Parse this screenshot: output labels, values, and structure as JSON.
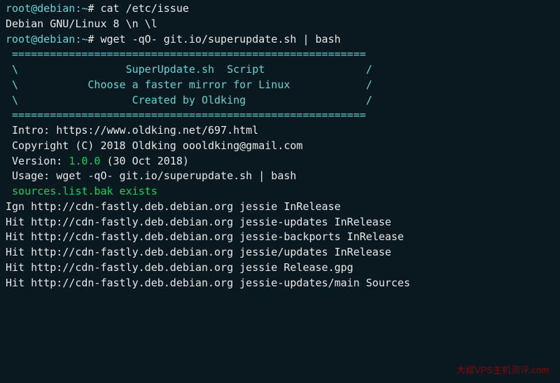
{
  "prompt1": {
    "user": "root",
    "at": "@",
    "host": "debian",
    "colon": ":",
    "path": "~",
    "hash": "# ",
    "cmd": "cat /etc/issue"
  },
  "issue_output": "Debian GNU/Linux 8 \\n \\l",
  "blank1": "",
  "prompt2": {
    "user": "root",
    "at": "@",
    "host": "debian",
    "colon": ":",
    "path": "~",
    "hash": "# ",
    "cmd": "wget -qO- git.io/superupdate.sh | bash"
  },
  "blank2": "",
  "banner": {
    "rule1": " ========================================================",
    "l1": " \\                 SuperUpdate.sh  Script                /",
    "l2": " \\           Choose a faster mirror for Linux            /",
    "l3": " \\                  Created by Oldking                   /",
    "rule2": " ========================================================"
  },
  "blank3": "",
  "info": {
    "intro": " Intro: https://www.oldking.net/697.html",
    "copyright": " Copyright (C) 2018 Oldking oooldking@gmail.com",
    "version_prefix": " Version: ",
    "version_num": "1.0.0",
    "version_suffix": " (30 Oct 2018)",
    "usage": " Usage: wget -qO- git.io/superupdate.sh | bash"
  },
  "blank4": "",
  "bak": " sources.list.bak exists",
  "apt": {
    "l1": "Ign http://cdn-fastly.deb.debian.org jessie InRelease",
    "l2": "Hit http://cdn-fastly.deb.debian.org jessie-updates InRelease",
    "l3": "Hit http://cdn-fastly.deb.debian.org jessie-backports InRelease",
    "l4": "Hit http://cdn-fastly.deb.debian.org jessie/updates InRelease",
    "l5": "Hit http://cdn-fastly.deb.debian.org jessie Release.gpg",
    "l6": "Hit http://cdn-fastly.deb.debian.org jessie-updates/main Sources"
  },
  "watermark": "大叔VPS主机测评.com"
}
